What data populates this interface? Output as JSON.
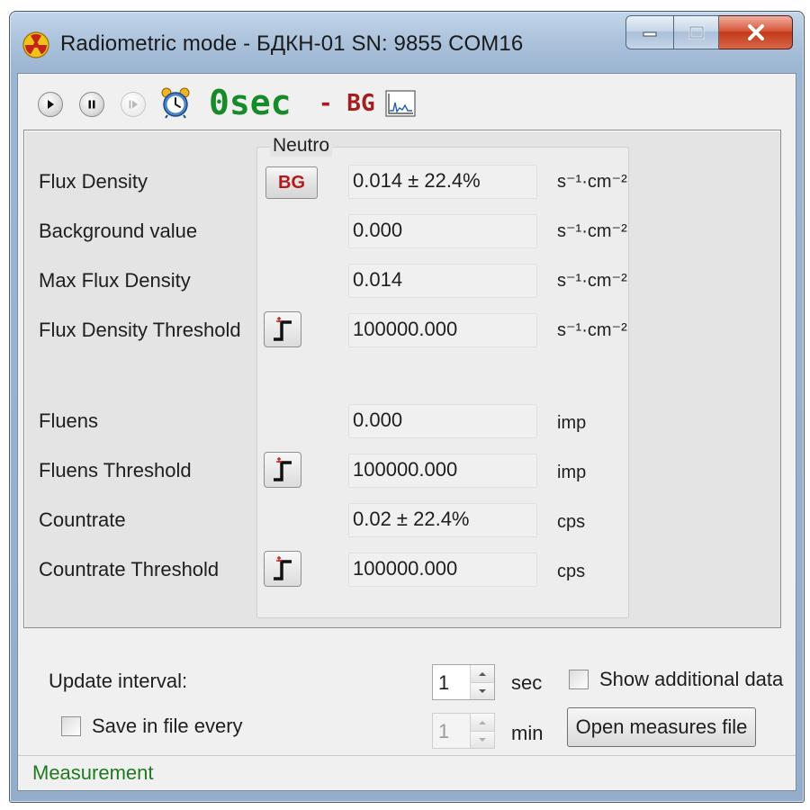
{
  "window": {
    "title": "Radiometric mode - БДКН-01 SN: 9855 COM16",
    "minimize_icon": "minimize-icon",
    "maximize_icon": "maximize-icon",
    "close_icon": "close-icon",
    "app_icon": "radiation-icon"
  },
  "toolbar": {
    "play_icon": "play-icon",
    "pause_icon": "pause-icon",
    "step_icon": "step-forward-icon",
    "alarm_icon": "alarm-clock-icon",
    "timer": "0sec",
    "bg_indicator": "- BG",
    "graph_icon": "graph-icon"
  },
  "group": {
    "legend": "Neutro"
  },
  "rows": [
    {
      "label": "Flux Density",
      "value": "0.014 ± 22.4%",
      "unit": "s⁻¹·cm⁻²",
      "button": "BG"
    },
    {
      "label": "Background value",
      "value": "0.000",
      "unit": "s⁻¹·cm⁻²"
    },
    {
      "label": "Max Flux Density",
      "value": "0.014",
      "unit": "s⁻¹·cm⁻²"
    },
    {
      "label": "Flux Density Threshold",
      "value": "100000.000",
      "unit": "s⁻¹·cm⁻²",
      "button_icon": "threshold-icon"
    },
    {
      "label": "Fluens",
      "value": "0.000",
      "unit": "imp"
    },
    {
      "label": "Fluens Threshold",
      "value": "100000.000",
      "unit": "imp",
      "button_icon": "threshold-icon"
    },
    {
      "label": "Countrate",
      "value": "0.02 ± 22.4%",
      "unit": "cps"
    },
    {
      "label": "Countrate Threshold",
      "value": "100000.000",
      "unit": "cps",
      "button_icon": "threshold-icon"
    }
  ],
  "bottom": {
    "update_interval_label": "Update interval:",
    "update_interval_value": "1",
    "update_interval_unit": "sec",
    "show_additional_label": "Show additional data",
    "show_additional_checked": false,
    "save_in_file_label": "Save in file every",
    "save_in_file_checked": false,
    "save_interval_value": "1",
    "save_interval_unit": "min",
    "open_button": "Open measures file"
  },
  "status": {
    "text": "Measurement"
  },
  "colors": {
    "timer": "#178a2a",
    "bg_indicator": "#a51d1d",
    "status_text": "#1f7a1f"
  }
}
